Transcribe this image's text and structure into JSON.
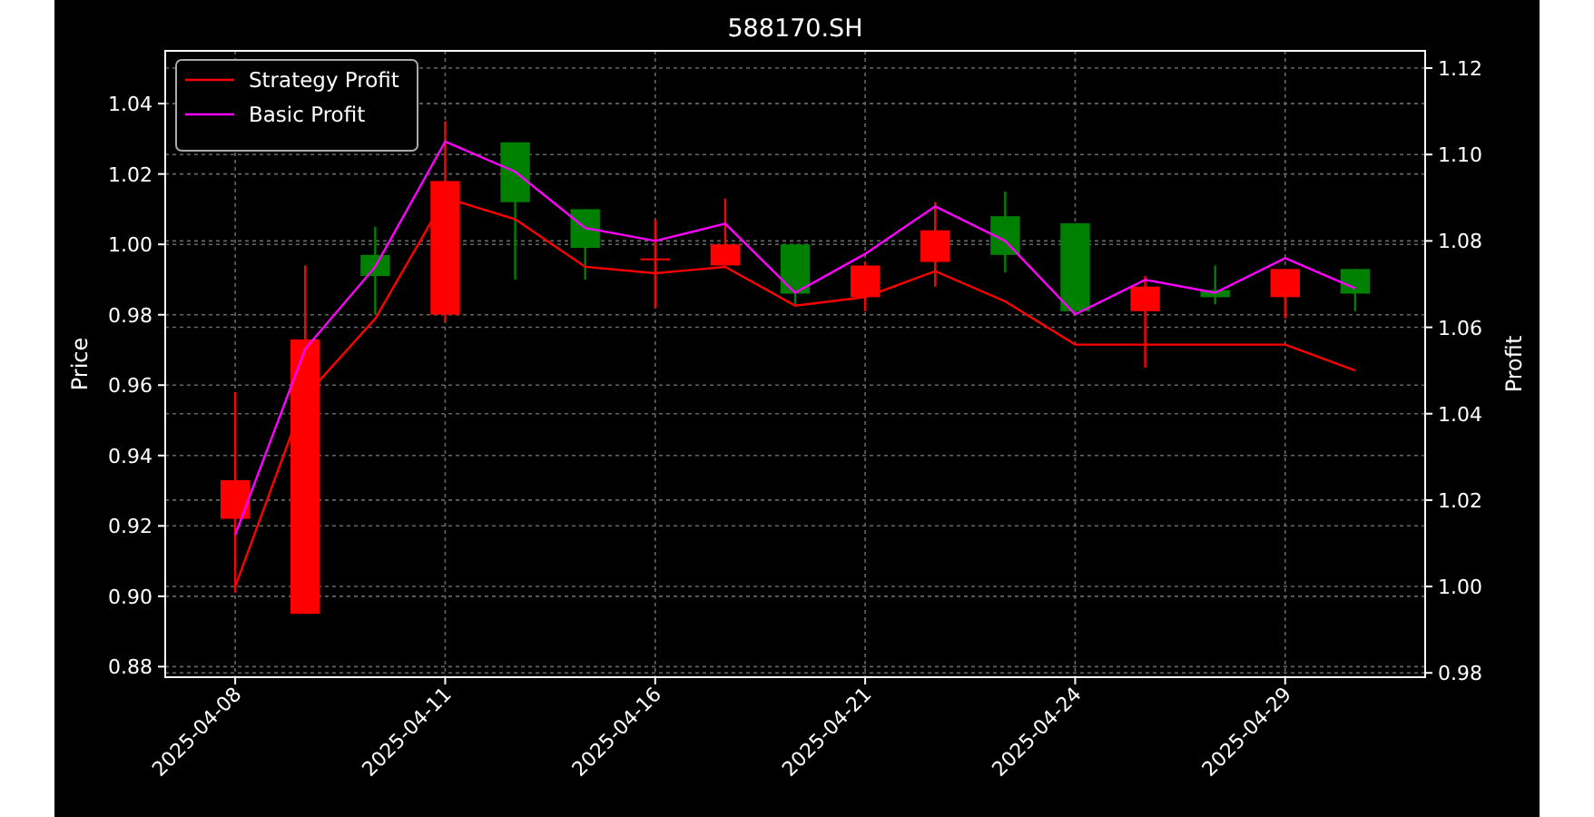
{
  "chart": {
    "chart_data": {
      "type": "line",
      "title": "588170.SH",
      "ylabel": "Price",
      "y2label": "Profit",
      "categories": [
        "2025-04-08",
        null,
        null,
        "2025-04-11",
        null,
        null,
        "2025-04-16",
        null,
        null,
        "2025-04-21",
        null,
        null,
        "2025-04-24",
        null,
        null,
        "2025-04-29",
        null
      ],
      "grid": true,
      "legend": true,
      "ylim": [
        0.877,
        1.055
      ],
      "y2lim": [
        0.979,
        1.124
      ],
      "yticks": [
        {
          "value": 0.88,
          "label": "0.88"
        },
        {
          "value": 0.9,
          "label": "0.90"
        },
        {
          "value": 0.92,
          "label": "0.92"
        },
        {
          "value": 0.94,
          "label": "0.94"
        },
        {
          "value": 0.96,
          "label": "0.96"
        },
        {
          "value": 0.98,
          "label": "0.98"
        },
        {
          "value": 1.0,
          "label": "1.00"
        },
        {
          "value": 1.02,
          "label": "1.02"
        },
        {
          "value": 1.04,
          "label": "1.04"
        }
      ],
      "y2ticks": [
        {
          "value": 0.98,
          "label": "0.98"
        },
        {
          "value": 1.0,
          "label": "1.00"
        },
        {
          "value": 1.02,
          "label": "1.02"
        },
        {
          "value": 1.04,
          "label": "1.04"
        },
        {
          "value": 1.06,
          "label": "1.06"
        },
        {
          "value": 1.08,
          "label": "1.08"
        },
        {
          "value": 1.1,
          "label": "1.10"
        },
        {
          "value": 1.12,
          "label": "1.12"
        }
      ],
      "series": [
        {
          "name": "Strategy Profit",
          "color": "#ff0000",
          "axis": "y2",
          "values": [
            1.0,
            1.044,
            1.062,
            1.09,
            1.085,
            1.074,
            1.0725,
            1.074,
            1.065,
            1.067,
            1.073,
            1.066,
            1.056,
            1.056,
            1.056,
            1.056,
            1.05
          ]
        },
        {
          "name": "Basic Profit",
          "color": "#ff00ff",
          "axis": "y2",
          "values": [
            1.012,
            1.055,
            1.074,
            1.103,
            1.096,
            1.083,
            1.08,
            1.084,
            1.068,
            1.077,
            1.088,
            1.08,
            1.063,
            1.071,
            1.068,
            1.076,
            1.069
          ]
        }
      ]
    }
  }
}
